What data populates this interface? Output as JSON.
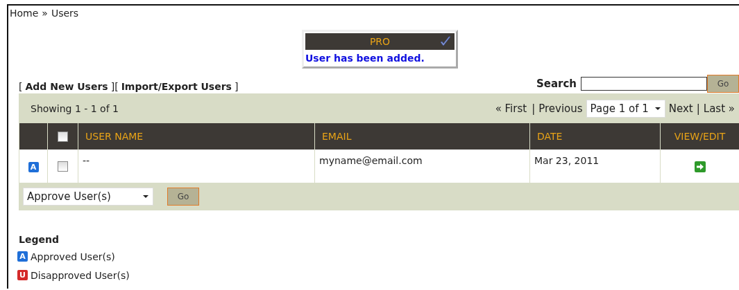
{
  "breadcrumb": {
    "items": [
      "Home",
      "Users"
    ],
    "separator": "»"
  },
  "notice": {
    "title": "PRO",
    "message": "User has been added."
  },
  "actions": {
    "open": "[",
    "between": "][",
    "close": "]",
    "links": [
      "Add New Users",
      "Import/Export Users"
    ]
  },
  "search": {
    "label": "Search",
    "button": "Go"
  },
  "pager": {
    "showing": "Showing 1 - 1 of 1",
    "first": "«  First",
    "sep1": "|",
    "previous": "Previous",
    "page": "Page 1 of 1",
    "next": "Next",
    "sep2": "|",
    "last": "Last »"
  },
  "table": {
    "header_checkbox": {
      "checked": false
    },
    "columns": [
      "USER NAME",
      "EMAIL",
      "DATE",
      "VIEW/EDIT"
    ],
    "rows": [
      {
        "status": "A",
        "color": "#1f6fd8",
        "checked": false,
        "user_name": "--",
        "email": "myname@email.com",
        "date": "Mar 23, 2011"
      }
    ]
  },
  "bulk": {
    "action": "Approve User(s)",
    "button": "Go"
  },
  "legend": {
    "title": "Legend",
    "items": [
      {
        "badge": "A",
        "color": "#1f6fd8",
        "label": "Approved User(s)"
      },
      {
        "badge": "U",
        "color": "#d42a2a",
        "label": "Disapproved User(s)"
      }
    ]
  }
}
